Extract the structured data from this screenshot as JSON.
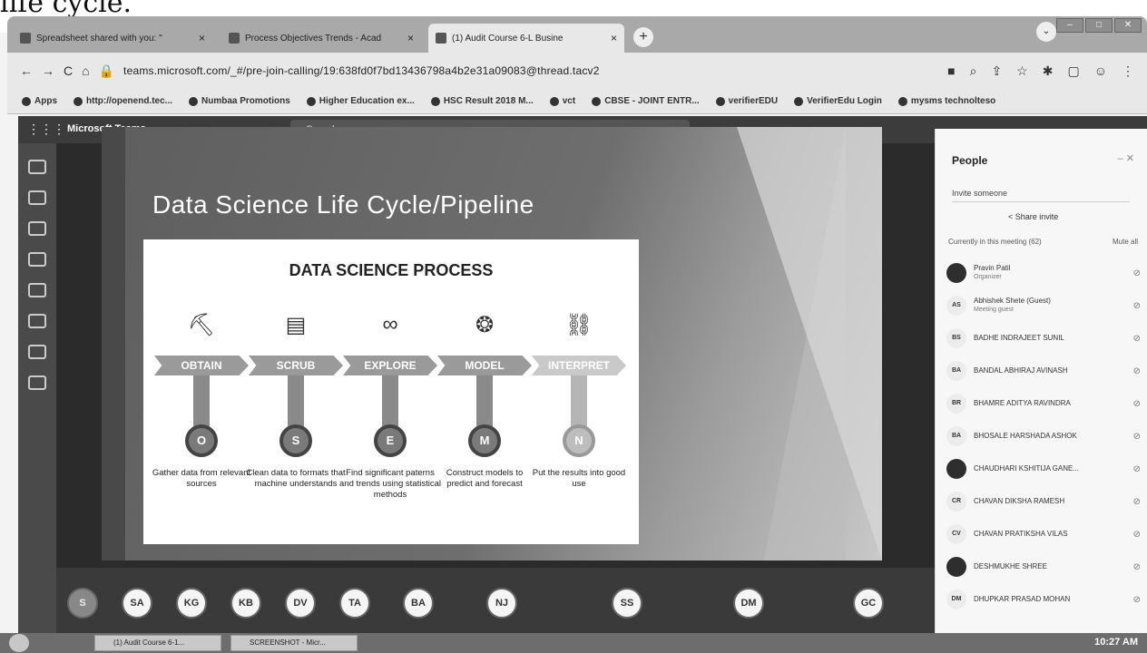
{
  "caption_fragment": "life cycle.",
  "browser": {
    "tabs": [
      {
        "label": "Spreadsheet shared with you: \"",
        "close": "×"
      },
      {
        "label": "Process Objectives Trends - Acad",
        "close": "×"
      },
      {
        "label": "(1) Audit Course 6-L Busine",
        "close": "×"
      }
    ],
    "new_tab": "+",
    "url": "teams.microsoft.com/_#/pre-join-calling/19:638fd0f7bd13436798a4b2e31a09083@thread.tacv2",
    "bookmarks": [
      "Apps",
      "http://openend.tec...",
      "Numbaa Promotions",
      "Higher Education ex...",
      "HSC Result 2018 M...",
      "vct",
      "CBSE - JOINT ENTR...",
      "verifierEDU",
      "VerifierEdu Login",
      "mysms technolteso"
    ]
  },
  "teams": {
    "app_name": "Microsoft Teams",
    "search_placeholder": "Search"
  },
  "slide": {
    "title": "Data Science Life Cycle/Pipeline",
    "process_title": "DATA SCIENCE PROCESS",
    "steps": [
      {
        "label": "OBTAIN",
        "letter": "O",
        "desc": "Gather data from relevant sources"
      },
      {
        "label": "SCRUB",
        "letter": "S",
        "desc": "Clean data to formats that machine understands"
      },
      {
        "label": "EXPLORE",
        "letter": "E",
        "desc": "Find significant paterns and trends using statistical methods"
      },
      {
        "label": "MODEL",
        "letter": "M",
        "desc": "Construct models to predict and forecast"
      },
      {
        "label": "INTERPRET",
        "letter": "N",
        "desc": "Put the results into good use"
      }
    ]
  },
  "participants": [
    "SA",
    "KG",
    "KB",
    "DV",
    "TA",
    "BA",
    "NJ",
    "SS",
    "DM",
    "GC"
  ],
  "people_panel": {
    "title": "People",
    "invite_placeholder": "Invite someone",
    "share_invite": "Share invite",
    "current_label": "Currently in this meeting (62)",
    "mute_all": "Mute all",
    "people": [
      {
        "initials": "",
        "name": "Pravin Patil",
        "role": "Organizer"
      },
      {
        "initials": "AS",
        "name": "Abhishek Shete (Guest)",
        "role": "Meeting guest"
      },
      {
        "initials": "BS",
        "name": "BADHE INDRAJEET SUNIL",
        "role": ""
      },
      {
        "initials": "BA",
        "name": "BANDAL ABHIRAJ AVINASH",
        "role": ""
      },
      {
        "initials": "BR",
        "name": "BHAMRE ADITYA RAVINDRA",
        "role": ""
      },
      {
        "initials": "BA",
        "name": "BHOSALE HARSHADA ASHOK",
        "role": ""
      },
      {
        "initials": "",
        "name": "CHAUDHARI KSHITIJA GANE...",
        "role": ""
      },
      {
        "initials": "CR",
        "name": "CHAVAN DIKSHA RAMESH",
        "role": ""
      },
      {
        "initials": "CV",
        "name": "CHAVAN PRATIKSHA VILAS",
        "role": ""
      },
      {
        "initials": "",
        "name": "DESHMUKHE SHREE",
        "role": ""
      },
      {
        "initials": "DM",
        "name": "DHUPKAR PRASAD MOHAN",
        "role": ""
      }
    ]
  },
  "taskbar": {
    "items": [
      "(1) Audit Course 6-1...",
      "SCREENSHOT - Micr..."
    ],
    "clock": "10:27 AM"
  }
}
